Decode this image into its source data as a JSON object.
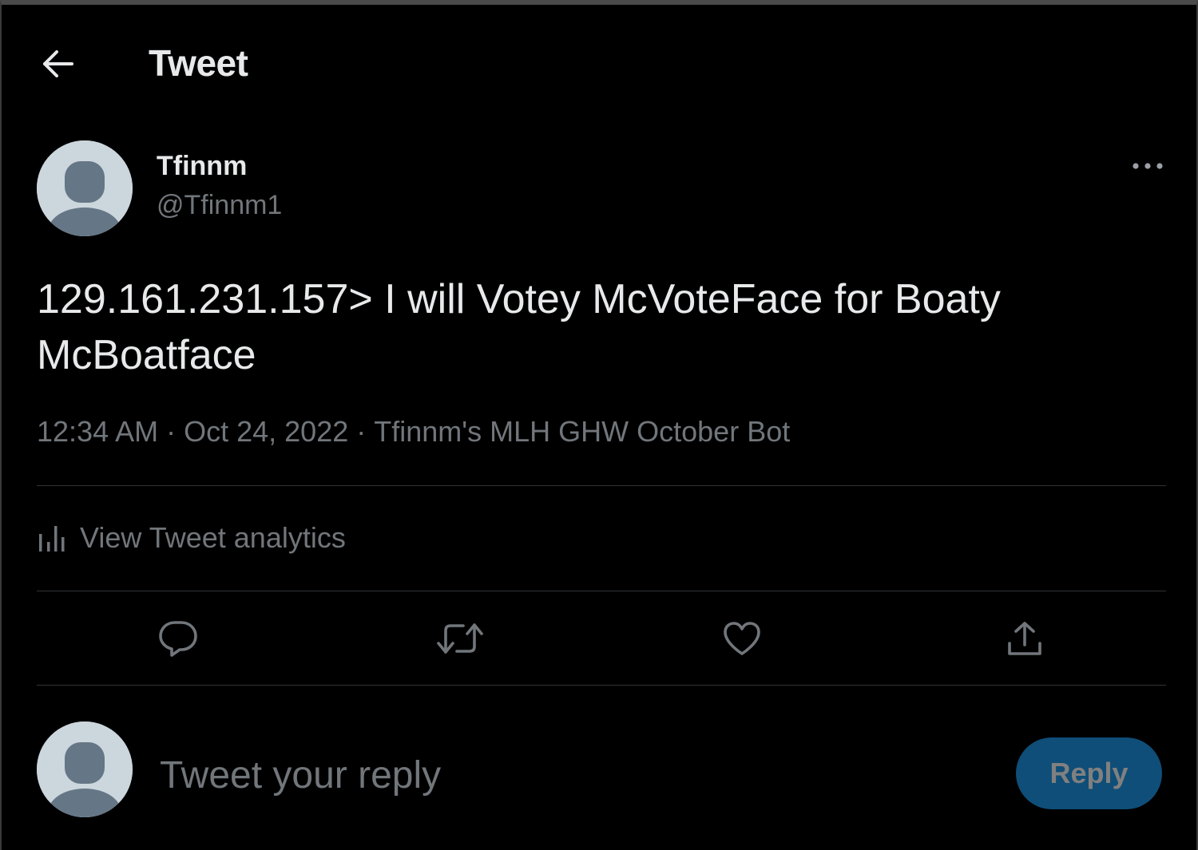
{
  "header": {
    "title": "Tweet"
  },
  "tweet": {
    "author_name": "Tfinnm",
    "author_handle": "@Tfinnm1",
    "text": "129.161.231.157> I will Votey McVoteFace for Boaty McBoatface",
    "time": "12:34 AM",
    "date": "Oct 24, 2022",
    "separator": "·",
    "source": "Tfinnm's MLH GHW October Bot"
  },
  "analytics": {
    "label": "View Tweet analytics"
  },
  "icons": {
    "back": "arrow-left-icon",
    "more": "more-horizontal-icon",
    "analytics": "bar-chart-icon",
    "reply": "speech-bubble-icon",
    "retweet": "retweet-icon",
    "like": "heart-icon",
    "share": "share-upload-icon",
    "avatar": "default-user-silhouette"
  },
  "reply_box": {
    "placeholder": "Tweet your reply",
    "button_label": "Reply"
  },
  "colors": {
    "background": "#000000",
    "primary_text": "#e7e9ea",
    "secondary_text": "#71767b",
    "divider": "#2f3336",
    "avatar_bg": "#ccd6dd",
    "avatar_silhouette": "#657786",
    "reply_button_bg": "#0f4e78",
    "reply_button_text": "#808080"
  }
}
